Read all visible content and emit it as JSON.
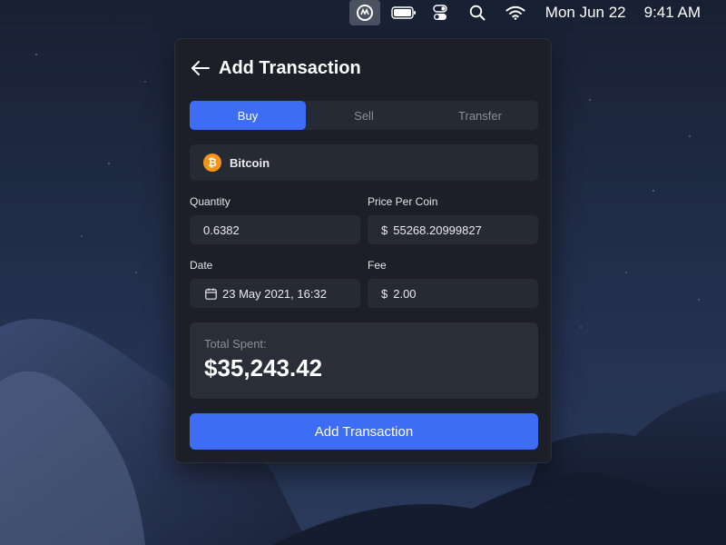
{
  "menubar": {
    "app_icon": "coinmarketcap-icon",
    "date": "Mon Jun 22",
    "time": "9:41 AM"
  },
  "panel": {
    "title": "Add Transaction",
    "tabs": [
      {
        "label": "Buy",
        "active": true
      },
      {
        "label": "Sell",
        "active": false
      },
      {
        "label": "Transfer",
        "active": false
      }
    ],
    "coin": {
      "symbol_glyph": "₿",
      "name": "Bitcoin"
    },
    "quantity": {
      "label": "Quantity",
      "value": "0.6382"
    },
    "price": {
      "label": "Price Per Coin",
      "prefix": "$",
      "value": "55268.20999827"
    },
    "date": {
      "label": "Date",
      "value": "23 May 2021, 16:32"
    },
    "fee": {
      "label": "Fee",
      "prefix": "$",
      "value": "2.00"
    },
    "total": {
      "label": "Total Spent:",
      "value": "$35,243.42"
    },
    "submit_label": "Add Transaction"
  },
  "colors": {
    "accent": "#3d6cf5",
    "panel_bg": "#1c1f27",
    "field_bg": "#262a34",
    "bitcoin": "#f7931a"
  }
}
